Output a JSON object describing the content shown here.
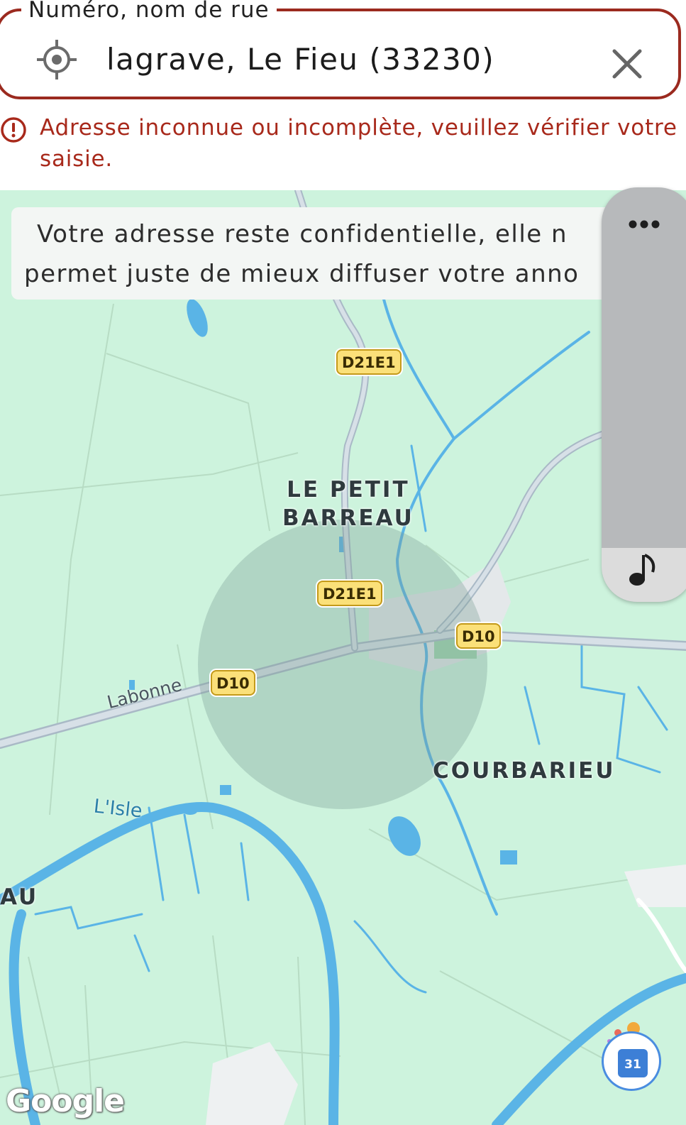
{
  "address_field": {
    "label": "Numéro, nom de rue",
    "value": "lagrave, Le Fieu (33230)"
  },
  "error": {
    "message": "Adresse inconnue ou incomplète, veuillez vérifier votre saisie."
  },
  "map": {
    "notice_line1": "Votre adresse reste confidentielle, elle n",
    "notice_line2": "permet juste de mieux diffuser votre anno",
    "road_labels": [
      "D21E1",
      "D21E1",
      "D10",
      "D10"
    ],
    "places": {
      "petit_barreau": "LE PETIT\nBARREAU",
      "courbarieu": "COURBARIEU",
      "au": "AU"
    },
    "street_labonne": "Labonne",
    "river_isle": "L'Isle",
    "attribution": "Google"
  },
  "side_panel": {
    "more_icon": "more-horizontal-icon",
    "music_icon": "music-note-icon"
  },
  "calendar": {
    "day": "31",
    "icon": "calendar-icon"
  },
  "colors": {
    "error": "#a8291b",
    "field_border": "#9b2a1f",
    "map_land": "#cdf3dd",
    "water": "#5ab4e6",
    "shield": "#fbe079"
  }
}
